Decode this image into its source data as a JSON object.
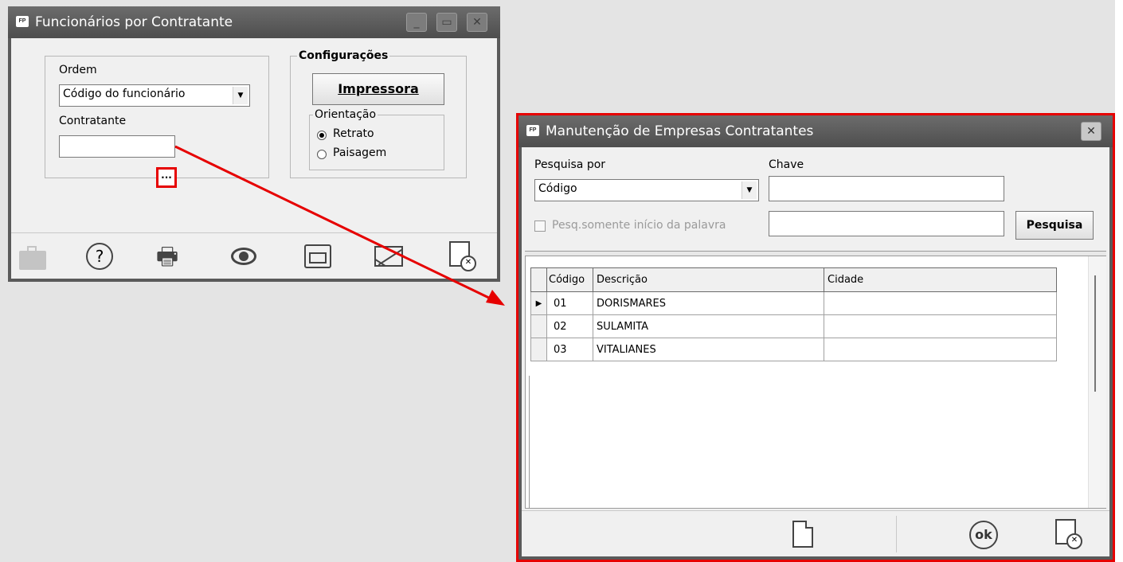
{
  "window1": {
    "title": "Funcionários por Contratante",
    "icon_text": "FP",
    "ordem": {
      "label": "Ordem",
      "selected": "Código do funcionário"
    },
    "contratante": {
      "label": "Contratante",
      "value": "",
      "ellipsis": "..."
    },
    "configuracoes": {
      "legend": "Configurações",
      "printer_button": "Impressora",
      "orientacao": {
        "legend": "Orientação",
        "option1": "Retrato",
        "option2": "Paisagem",
        "selected": "Retrato"
      }
    },
    "toolbar": [
      "briefcase-icon",
      "help-icon",
      "printer-icon",
      "preview-eye-icon",
      "folder-icon",
      "email-icon",
      "close-document-icon"
    ]
  },
  "window2": {
    "title": "Manutenção de Empresas Contratantes",
    "icon_text": "FP",
    "pesquisa_por": {
      "label": "Pesquisa por",
      "selected": "Código"
    },
    "chave": {
      "label": "Chave",
      "value": ""
    },
    "checkbox_label": "Pesq.somente início da palavra",
    "checkbox_checked": false,
    "search_button": "Pesquisa",
    "grid": {
      "columns": [
        "Código",
        "Descrição",
        "Cidade"
      ],
      "rows": [
        {
          "codigo": "01",
          "descricao": "DORISMARES",
          "cidade": ""
        },
        {
          "codigo": "02",
          "descricao": "SULAMITA",
          "cidade": ""
        },
        {
          "codigo": "03",
          "descricao": "VITALIANES",
          "cidade": ""
        }
      ]
    },
    "footer_icons": [
      "new-document-icon",
      "ok-icon",
      "close-document-icon"
    ],
    "ok_text": "ok"
  },
  "annotation_color": "#e60000"
}
